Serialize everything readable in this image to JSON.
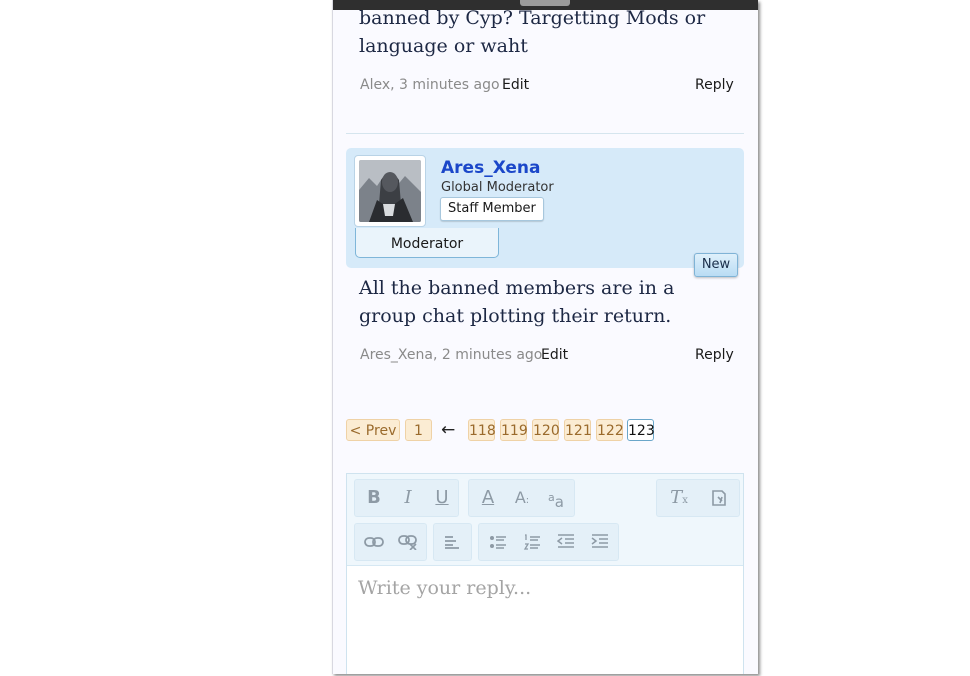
{
  "post1": {
    "text": "banned by Cyp? Targetting Mods or language or waht",
    "meta": "Alex, 3 minutes ago",
    "edit_label": "Edit",
    "reply_label": "Reply"
  },
  "post2": {
    "username": "Ares_Xena",
    "user_title": "Global Moderator",
    "staff_badge": "Staff Member",
    "banner": "Moderator",
    "new_badge": "New",
    "text": "All the banned members are in a group chat plotting their return.",
    "meta": "Ares_Xena, 2 minutes ago",
    "edit_label": "Edit",
    "reply_label": "Reply"
  },
  "pagination": {
    "prev_label": "< Prev",
    "first_page": "1",
    "skip_arrow": "←",
    "pages": [
      "118",
      "119",
      "120",
      "121",
      "122",
      "123"
    ],
    "current_page": "123"
  },
  "editor": {
    "placeholder": "Write your reply...",
    "toolbar_icons": [
      "bold-icon",
      "italic-icon",
      "underline-icon",
      "text-color-icon",
      "font-size-icon",
      "font-family-icon",
      "remove-format-icon",
      "toggle-bbcode-icon",
      "link-icon",
      "unlink-icon",
      "align-icon",
      "bullet-list-icon",
      "numbered-list-icon",
      "outdent-icon",
      "indent-icon"
    ]
  },
  "colors": {
    "username": "#1b47c9",
    "userblock_bg": "#d6eaf9",
    "page_button_bg": "#fbecd3",
    "post_text": "#1d2844"
  }
}
